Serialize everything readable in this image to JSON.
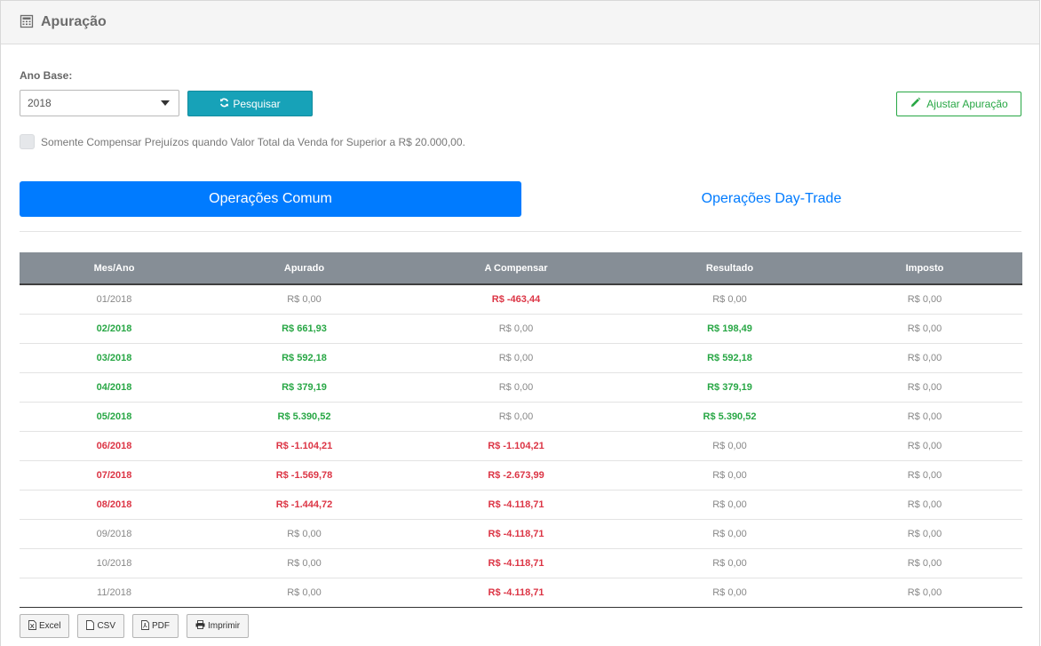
{
  "header": {
    "title": "Apuração",
    "icon": "calculator-icon"
  },
  "filters": {
    "ano_base_label": "Ano Base:",
    "ano_base_value": "2018",
    "pesquisar_label": "Pesquisar",
    "ajustar_label": "Ajustar Apuração",
    "checkbox_label": "Somente Compensar Prejuízos quando Valor Total da Venda for Superior a R$ 20.000,00.",
    "checkbox_checked": false
  },
  "tabs": [
    {
      "label": "Operações Comum",
      "active": true
    },
    {
      "label": "Operações Day-Trade",
      "active": false
    }
  ],
  "table": {
    "columns": [
      "Mes/Ano",
      "Apurado",
      "A Compensar",
      "Resultado",
      "Imposto"
    ],
    "rows": [
      {
        "mes": "01/2018",
        "apurado": "R$ 0,00",
        "compensar": "R$ -463,44",
        "resultado": "R$ 0,00",
        "imposto": "R$ 0,00",
        "status": [
          "neutral",
          "neutral",
          "red",
          "neutral",
          "neutral"
        ]
      },
      {
        "mes": "02/2018",
        "apurado": "R$ 661,93",
        "compensar": "R$ 0,00",
        "resultado": "R$ 198,49",
        "imposto": "R$ 0,00",
        "status": [
          "green",
          "green",
          "neutral",
          "green",
          "neutral"
        ]
      },
      {
        "mes": "03/2018",
        "apurado": "R$ 592,18",
        "compensar": "R$ 0,00",
        "resultado": "R$ 592,18",
        "imposto": "R$ 0,00",
        "status": [
          "green",
          "green",
          "neutral",
          "green",
          "neutral"
        ]
      },
      {
        "mes": "04/2018",
        "apurado": "R$ 379,19",
        "compensar": "R$ 0,00",
        "resultado": "R$ 379,19",
        "imposto": "R$ 0,00",
        "status": [
          "green",
          "green",
          "neutral",
          "green",
          "neutral"
        ]
      },
      {
        "mes": "05/2018",
        "apurado": "R$ 5.390,52",
        "compensar": "R$ 0,00",
        "resultado": "R$ 5.390,52",
        "imposto": "R$ 0,00",
        "status": [
          "green",
          "green",
          "neutral",
          "green",
          "neutral"
        ]
      },
      {
        "mes": "06/2018",
        "apurado": "R$ -1.104,21",
        "compensar": "R$ -1.104,21",
        "resultado": "R$ 0,00",
        "imposto": "R$ 0,00",
        "status": [
          "red",
          "red",
          "red",
          "neutral",
          "neutral"
        ]
      },
      {
        "mes": "07/2018",
        "apurado": "R$ -1.569,78",
        "compensar": "R$ -2.673,99",
        "resultado": "R$ 0,00",
        "imposto": "R$ 0,00",
        "status": [
          "red",
          "red",
          "red",
          "neutral",
          "neutral"
        ]
      },
      {
        "mes": "08/2018",
        "apurado": "R$ -1.444,72",
        "compensar": "R$ -4.118,71",
        "resultado": "R$ 0,00",
        "imposto": "R$ 0,00",
        "status": [
          "red",
          "red",
          "red",
          "neutral",
          "neutral"
        ]
      },
      {
        "mes": "09/2018",
        "apurado": "R$ 0,00",
        "compensar": "R$ -4.118,71",
        "resultado": "R$ 0,00",
        "imposto": "R$ 0,00",
        "status": [
          "neutral",
          "neutral",
          "red",
          "neutral",
          "neutral"
        ]
      },
      {
        "mes": "10/2018",
        "apurado": "R$ 0,00",
        "compensar": "R$ -4.118,71",
        "resultado": "R$ 0,00",
        "imposto": "R$ 0,00",
        "status": [
          "neutral",
          "neutral",
          "red",
          "neutral",
          "neutral"
        ]
      },
      {
        "mes": "11/2018",
        "apurado": "R$ 0,00",
        "compensar": "R$ -4.118,71",
        "resultado": "R$ 0,00",
        "imposto": "R$ 0,00",
        "status": [
          "neutral",
          "neutral",
          "red",
          "neutral",
          "neutral"
        ]
      }
    ]
  },
  "export": {
    "excel": "Excel",
    "csv": "CSV",
    "pdf": "PDF",
    "imprimir": "Imprimir"
  },
  "colors": {
    "primary": "#007bff",
    "info": "#17a2b8",
    "success": "#28a745",
    "danger": "#dc3545",
    "table_header": "#868e96"
  }
}
